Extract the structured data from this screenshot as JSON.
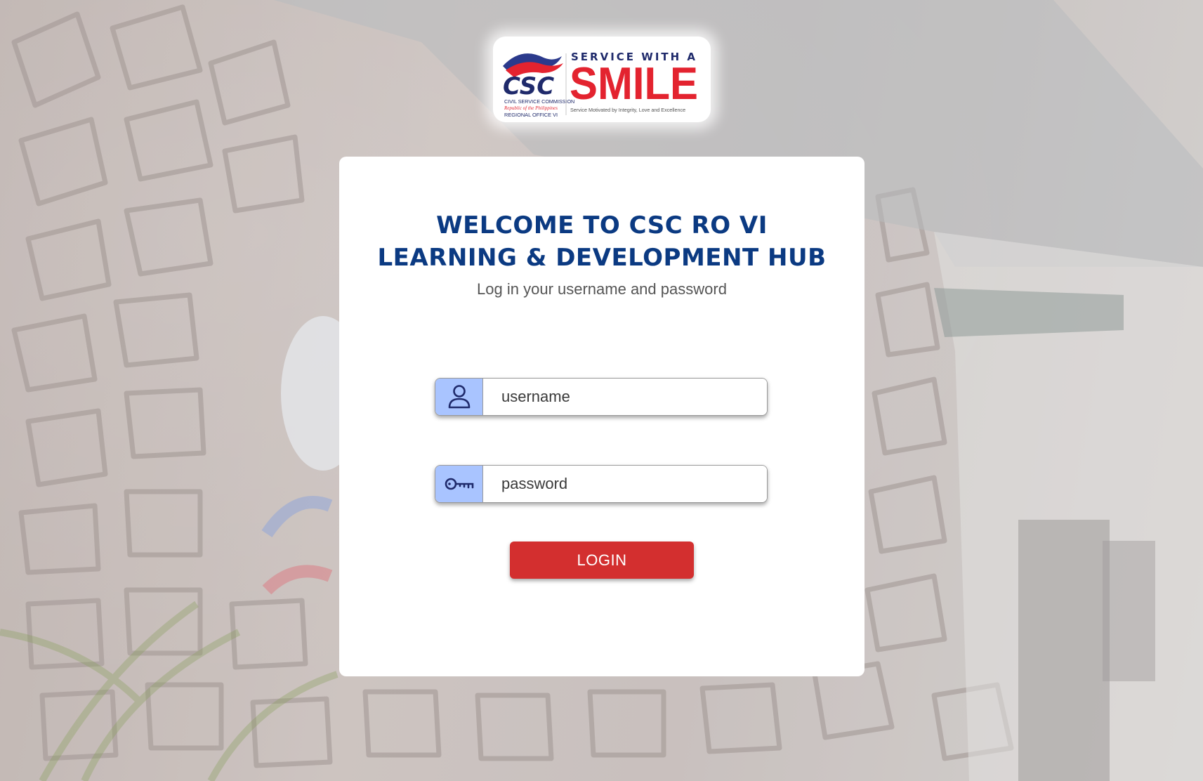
{
  "logo": {
    "acronym": "CSC",
    "org_name": "CIVIL SERVICE COMMISSION",
    "country": "Republic of the Philippines",
    "office": "REGIONAL OFFICE VI",
    "tagline_top": "SERVICE WITH A",
    "tagline_big": "SMILE",
    "motto": "Service Motivated by Integrity, Love and Excellence"
  },
  "login": {
    "title_line1": "WELCOME TO CSC RO VI",
    "title_line2": "LEARNING & DEVELOPMENT HUB",
    "subtitle": "Log in your username and password",
    "username": {
      "placeholder": "username",
      "value": "",
      "icon": "user-icon"
    },
    "password": {
      "placeholder": "password",
      "value": "",
      "icon": "key-icon"
    },
    "submit_label": "LOGIN"
  },
  "colors": {
    "title": "#0b3a82",
    "button": "#d32f2f",
    "icon_box": "#a9c4ff",
    "smile_red": "#e3232f",
    "navy": "#1f2a6b"
  }
}
